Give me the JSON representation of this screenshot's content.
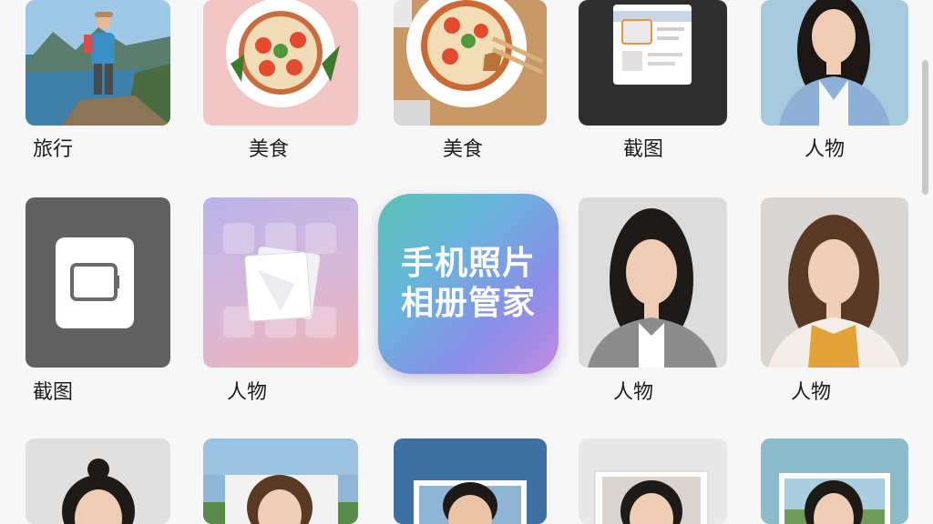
{
  "gallery": {
    "row1": [
      {
        "label": "旅行",
        "image": "travel-hiker-photo"
      },
      {
        "label": "美食",
        "image": "food-pizza-bowl"
      },
      {
        "label": "美食",
        "image": "food-pizza-bowl-with-fork"
      },
      {
        "label": "截图",
        "image": "screenshot-document"
      },
      {
        "label": "人物",
        "image": "portrait-woman-blazer"
      }
    ],
    "row2": [
      {
        "label": "截图",
        "image": "screenshot-icon"
      },
      {
        "label": "人物",
        "image": "stacked-photos-icon"
      },
      {
        "label": "人物",
        "image": "portrait-woman-grey"
      },
      {
        "label": "人物",
        "image": "portrait-woman-yellow"
      }
    ],
    "row3": [
      {
        "image": "portrait-woman-bun"
      },
      {
        "image": "portrait-woman-landscape"
      },
      {
        "image": "portrait-man-blue"
      },
      {
        "image": "portrait-woman-stacked"
      },
      {
        "image": "portrait-woman-teal"
      }
    ]
  },
  "app_icon": {
    "line1": "手机照片",
    "line2": "相册管家"
  },
  "colors": {
    "icon_gradient_start": "#58c2b2",
    "icon_gradient_end": "#c58ae0",
    "scrollbar": "#c9c9c9"
  }
}
